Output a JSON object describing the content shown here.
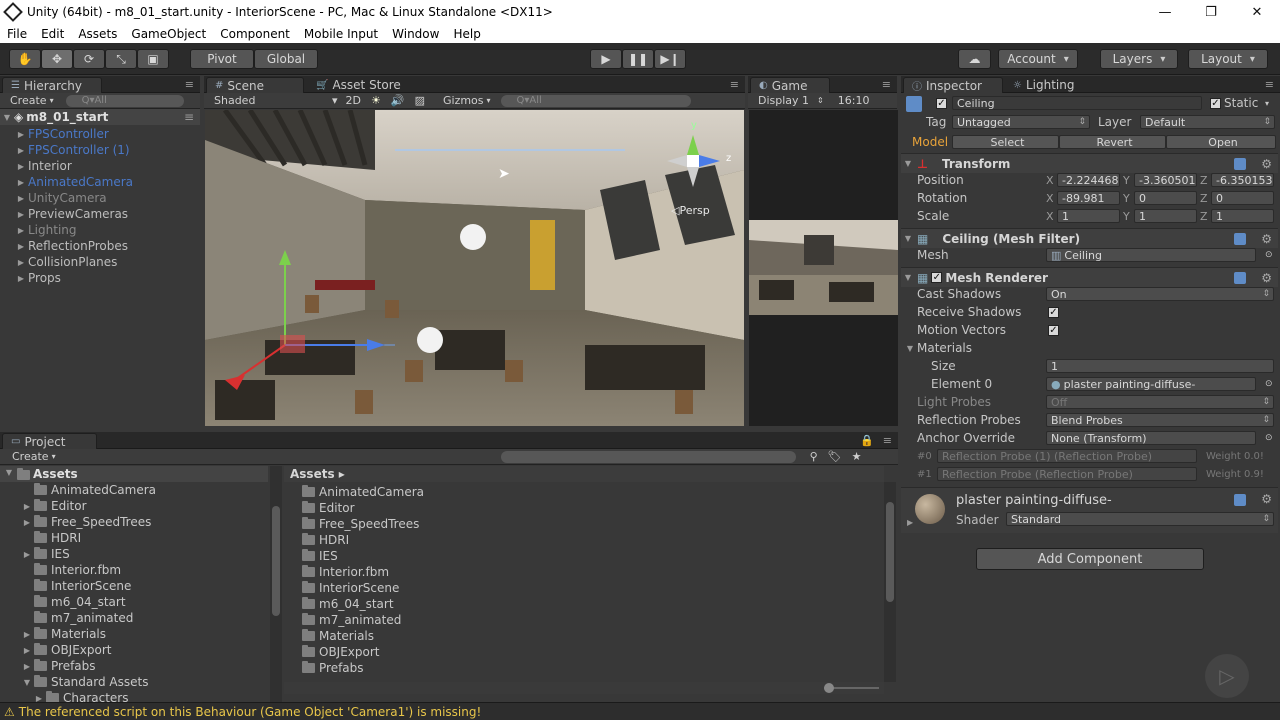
{
  "window": {
    "title": "Unity (64bit) - m8_01_start.unity - InteriorScene - PC, Mac & Linux Standalone <DX11>"
  },
  "menu": [
    "File",
    "Edit",
    "Assets",
    "GameObject",
    "Component",
    "Mobile Input",
    "Window",
    "Help"
  ],
  "toolbar": {
    "pivot": "Pivot",
    "global": "Global",
    "account": "Account",
    "layers": "Layers",
    "layout": "Layout"
  },
  "hierarchy": {
    "tab": "Hierarchy",
    "create": "Create",
    "search": "Q▾All",
    "scene": "m8_01_start",
    "items": [
      {
        "label": "FPSController",
        "style": "blue"
      },
      {
        "label": "FPSController (1)",
        "style": "blue"
      },
      {
        "label": "Interior",
        "style": "normal"
      },
      {
        "label": "AnimatedCamera",
        "style": "blue"
      },
      {
        "label": "UnityCamera",
        "style": "gray"
      },
      {
        "label": "PreviewCameras",
        "style": "normal"
      },
      {
        "label": "Lighting",
        "style": "gray"
      },
      {
        "label": "ReflectionProbes",
        "style": "normal"
      },
      {
        "label": "CollisionPlanes",
        "style": "normal"
      },
      {
        "label": "Props",
        "style": "normal"
      }
    ]
  },
  "scene": {
    "tab": "Scene",
    "asset_store": "Asset Store",
    "shaded": "Shaded",
    "mode2d": "2D",
    "gizmos": "Gizmos",
    "search": "Q▾All",
    "persp": "Persp",
    "axis_y": "y",
    "axis_z": "z"
  },
  "game": {
    "tab": "Game",
    "display": "Display 1",
    "aspect": "16:10"
  },
  "inspector": {
    "tab": "Inspector",
    "lighting": "Lighting",
    "object_name": "Ceiling",
    "static": "Static",
    "tag_label": "Tag",
    "tag": "Untagged",
    "layer_label": "Layer",
    "layer": "Default",
    "model": "Model",
    "select": "Select",
    "revert": "Revert",
    "open": "Open",
    "transform": {
      "title": "Transform",
      "position": {
        "label": "Position",
        "x": "-2.224468",
        "y": "-3.360501",
        "z": "-6.350153"
      },
      "rotation": {
        "label": "Rotation",
        "x": "-89.981",
        "y": "0",
        "z": "0"
      },
      "scale": {
        "label": "Scale",
        "x": "1",
        "y": "1",
        "z": "1"
      }
    },
    "mesh_filter": {
      "title": "Ceiling (Mesh Filter)",
      "mesh_label": "Mesh",
      "mesh": "Ceiling"
    },
    "mesh_renderer": {
      "title": "Mesh Renderer",
      "cast_shadows_label": "Cast Shadows",
      "cast_shadows": "On",
      "receive_shadows": "Receive Shadows",
      "motion_vectors": "Motion Vectors",
      "materials": "Materials",
      "size_label": "Size",
      "size": "1",
      "element0_label": "Element 0",
      "element0": "plaster painting-diffuse-",
      "light_probes_label": "Light Probes",
      "light_probes": "Off",
      "reflection_probes_label": "Reflection Probes",
      "reflection_probes": "Blend Probes",
      "anchor_label": "Anchor Override",
      "anchor": "None (Transform)",
      "probe0_label": "#0",
      "probe0": "Reflection Probe (1) (Reflection Probe)",
      "probe0_weight": "Weight 0.0!",
      "probe1_label": "#1",
      "probe1": "Reflection Probe (Reflection Probe)",
      "probe1_weight": "Weight 0.9!"
    },
    "material": {
      "name": "plaster painting-diffuse-",
      "shader_label": "Shader",
      "shader": "Standard"
    },
    "add_component": "Add Component"
  },
  "project": {
    "tab": "Project",
    "create": "Create",
    "assets_root": "Assets",
    "breadcrumb": "Assets ▸",
    "tree": [
      {
        "label": "AnimatedCamera",
        "expand": false
      },
      {
        "label": "Editor",
        "expand": true
      },
      {
        "label": "Free_SpeedTrees",
        "expand": true
      },
      {
        "label": "HDRI",
        "expand": false
      },
      {
        "label": "IES",
        "expand": true
      },
      {
        "label": "Interior.fbm",
        "expand": false
      },
      {
        "label": "InteriorScene",
        "expand": false
      },
      {
        "label": "m6_04_start",
        "expand": false
      },
      {
        "label": "m7_animated",
        "expand": false
      },
      {
        "label": "Materials",
        "expand": true
      },
      {
        "label": "OBJExport",
        "expand": true
      },
      {
        "label": "Prefabs",
        "expand": true
      },
      {
        "label": "Standard Assets",
        "expand": true
      },
      {
        "label": "Characters",
        "expand": true
      }
    ],
    "files": [
      "AnimatedCamera",
      "Editor",
      "Free_SpeedTrees",
      "HDRI",
      "IES",
      "Interior.fbm",
      "InteriorScene",
      "m6_04_start",
      "m7_animated",
      "Materials",
      "OBJExport",
      "Prefabs"
    ]
  },
  "status": {
    "message": "The referenced script on this Behaviour (Game Object 'Camera1') is missing!"
  },
  "colors": {
    "accent": "#5f8cc7",
    "warning": "#e8c64a",
    "model": "#e8a33a"
  }
}
